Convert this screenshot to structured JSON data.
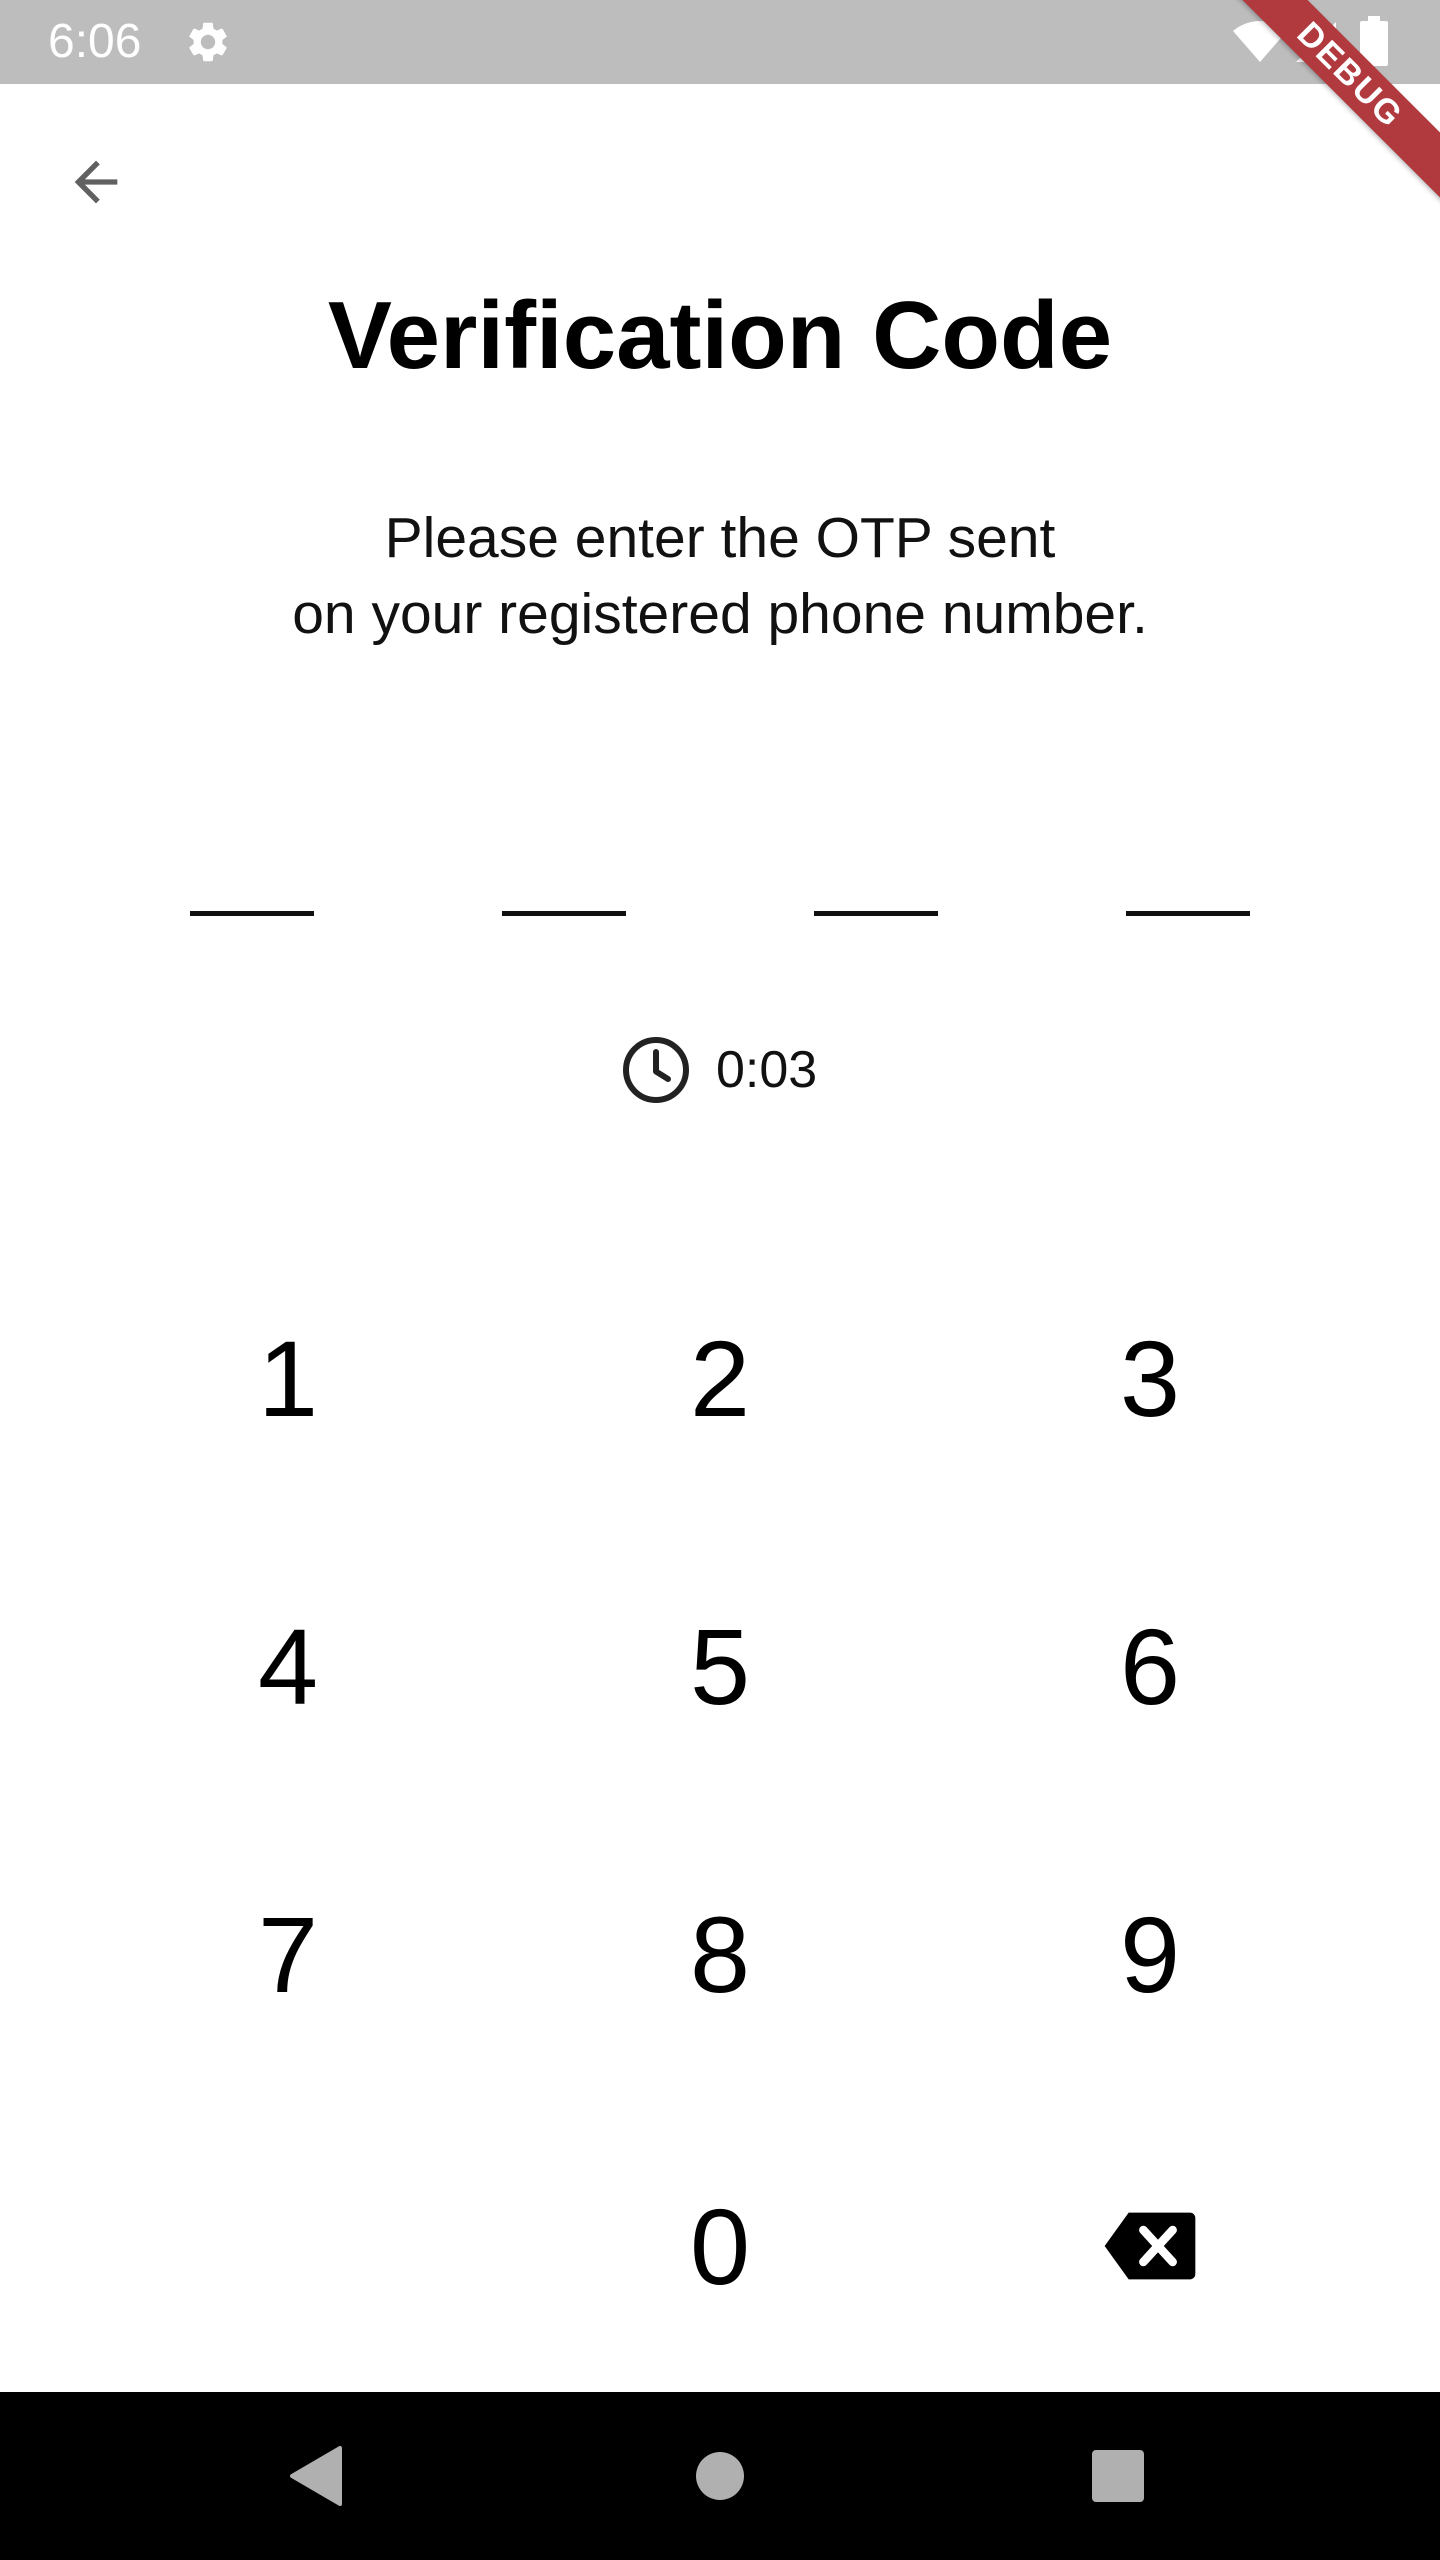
{
  "status_bar": {
    "time": "6:06",
    "icons": [
      "gear-icon",
      "wifi-icon",
      "signal-icon",
      "battery-icon"
    ]
  },
  "debug_banner": "DEBUG",
  "header": {
    "back_icon": "arrow-back-icon",
    "title": "Verification Code"
  },
  "subtitle": {
    "line1": "Please enter the OTP sent",
    "line2": "on your registered phone number."
  },
  "otp": {
    "digits": [
      "",
      "",
      "",
      ""
    ]
  },
  "timer": {
    "icon": "clock-icon",
    "value": "0:03"
  },
  "keypad": {
    "keys": [
      "1",
      "2",
      "3",
      "4",
      "5",
      "6",
      "7",
      "8",
      "9",
      "",
      "0",
      "backspace"
    ],
    "backspace_icon": "backspace-icon"
  },
  "nav_bar": {
    "icons": [
      "nav-back-icon",
      "nav-home-icon",
      "nav-recents-icon"
    ]
  },
  "colors": {
    "status_bar": "#bdbdbd",
    "debug_banner": "#b13a3f",
    "text": "#000000",
    "nav_bar": "#000000"
  }
}
